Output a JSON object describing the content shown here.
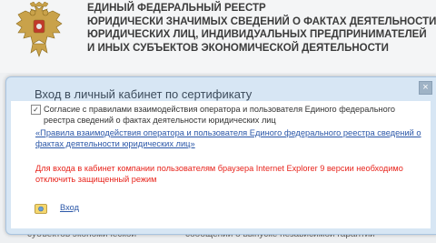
{
  "header": {
    "lines": [
      "ЕДИНЫЙ ФЕДЕРАЛЬНЫЙ РЕЕСТР",
      "ЮРИДИЧЕСКИ ЗНАЧИМЫХ СВЕДЕНИЙ О ФАКТАХ ДЕЯТЕЛЬНОСТИ",
      "ЮРИДИЧЕСКИХ ЛИЦ, ИНДИВИДУАЛЬНЫХ ПРЕДПРИНИМАТЕЛЕЙ",
      "И ИНЫХ СУБЪЕКТОВ ЭКОНОМИЧЕСКОЙ ДЕЯТЕЛЬНОСТИ"
    ]
  },
  "modal": {
    "title": "Вход в личный кабинет по сертификату",
    "close_label": "×",
    "consent_text": "Согласие с правилами взаимодействия оператора и пользователя Единого федерального реестра сведений о фактах деятельности юридических лиц",
    "rules_link": "«Правила взаимодействия оператора и пользователя Единого федерального реестра сведений о фактах деятельности юридических лиц»",
    "warning": "Для входа в кабинет компании пользователям браузера Internet Explorer 9 версии необходимо отключить защищенный режим",
    "enter_label": "Вход"
  },
  "background": {
    "bottom_left": "субъектов экономической",
    "bottom_right": "сообщений о выпуске независимой гарантии"
  },
  "colors": {
    "link": "#2b57a8",
    "warning": "#e8241c",
    "modal_frame": "#d7e6f4"
  }
}
